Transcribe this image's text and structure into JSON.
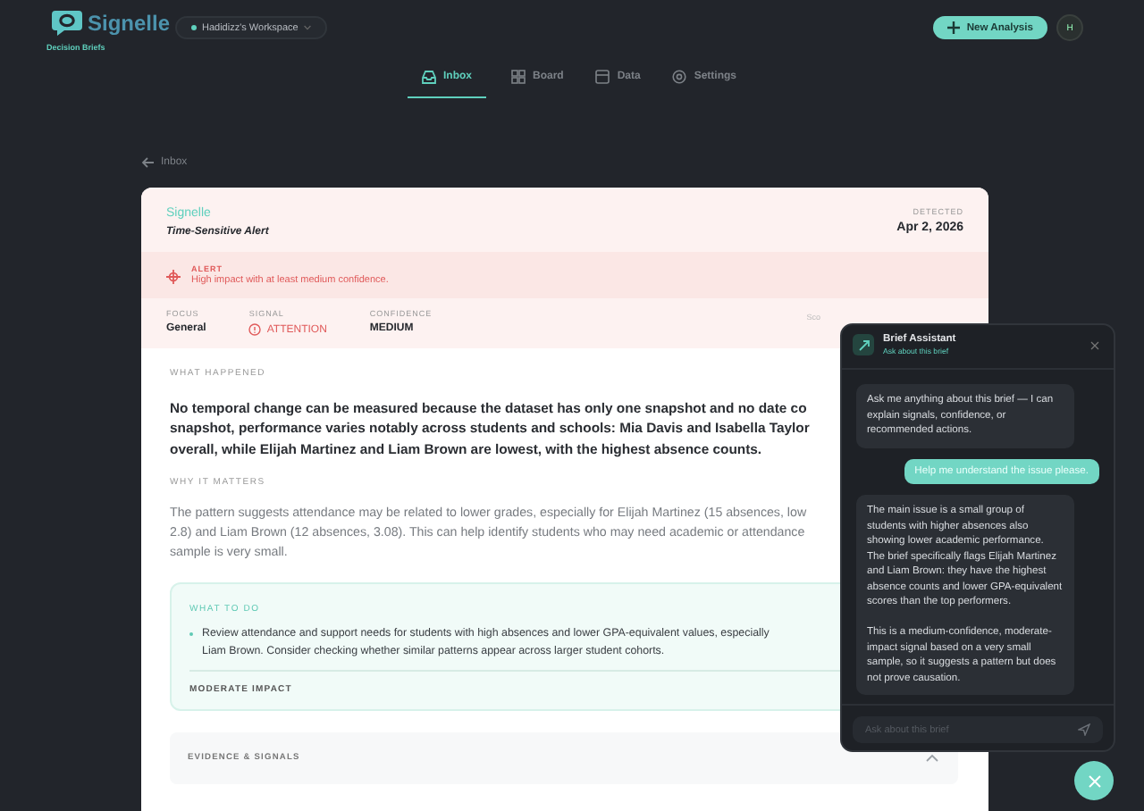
{
  "header": {
    "logo": "Signelle",
    "subtitle": "Decision Briefs",
    "workspace": "Hadidizz's Workspace",
    "new_button": "New Analysis",
    "avatar": "H"
  },
  "tabs": [
    {
      "label": "Inbox",
      "selected": true
    },
    {
      "label": "Board",
      "selected": false
    },
    {
      "label": "Data",
      "selected": false
    },
    {
      "label": "Settings",
      "selected": false
    }
  ],
  "back_link": "Inbox",
  "brief": {
    "source": "Signelle",
    "title": "Time-Sensitive Alert",
    "detected_label": "DETECTED",
    "detected_date": "Apr 2, 2026",
    "alert": {
      "label": "ALERT",
      "text": "High impact with at least medium confidence."
    },
    "stats": [
      {
        "label": "FOCUS",
        "value": "General",
        "kind": "plain"
      },
      {
        "label": "SIGNAL",
        "value": "ATTENTION",
        "kind": "signal"
      },
      {
        "label": "CONFIDENCE",
        "value": "MEDIUM",
        "kind": "plain"
      }
    ],
    "stat_cut": "Sco",
    "what_happened": {
      "heading": "WHAT HAPPENED",
      "lines": [
        "No temporal change can be measured because the dataset has only one snapshot and no date co",
        "snapshot, performance varies notably across students and schools: Mia Davis and Isabella Taylor",
        "overall, while Elijah Martinez and Liam Brown are lowest, with the highest absence counts."
      ]
    },
    "why_it_matters": {
      "heading": "WHY IT MATTERS",
      "lines": [
        "The pattern suggests attendance may be related to lower grades, especially for Elijah Martinez (15 absences, low",
        "2.8) and Liam Brown (12 absences, 3.08). This can help identify students who may need academic or attendance",
        "sample is very small."
      ]
    },
    "what_to_do": {
      "heading": "WHAT TO DO",
      "lines": [
        "Review attendance and support needs for students with high absences and lower GPA-equivalent values, especially",
        "Liam Brown. Consider checking whether similar patterns appear across larger student cohorts."
      ],
      "impact": "MODERATE IMPACT"
    },
    "evidence": {
      "heading": "EVIDENCE & SIGNALS",
      "expanded": true
    }
  },
  "chat": {
    "title": "Brief Assistant",
    "subtitle": "Ask about this brief",
    "messages": [
      {
        "kind": "assistant",
        "paragraphs": [
          "Ask me anything about this brief — I can explain signals, confidence, or recommended actions."
        ]
      },
      {
        "kind": "user",
        "paragraphs": [
          "Help me understand the issue please."
        ]
      },
      {
        "kind": "assistant",
        "paragraphs": [
          "The main issue is a small group of students with higher absences also showing lower academic performance. The brief specifically flags Elijah Martinez and Liam Brown: they have the highest absence counts and lower GPA-equivalent scores than the top performers.",
          "This is a medium-confidence, moderate-impact signal based on a very small sample, so it suggests a pattern but does not prove causation."
        ]
      }
    ],
    "placeholder": "Ask about this brief"
  }
}
